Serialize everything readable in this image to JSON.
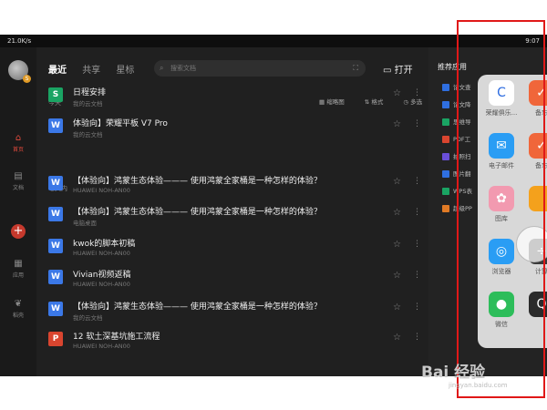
{
  "status": {
    "left": "21.0K/s",
    "right": "9:07"
  },
  "sidebar": {
    "items": [
      {
        "label": "首页"
      },
      {
        "label": "文档"
      },
      {
        "label": "应用"
      },
      {
        "label": "稻壳"
      }
    ]
  },
  "topnav": {
    "tabs": [
      "最近",
      "共享",
      "星标"
    ],
    "open_label": "打开"
  },
  "search": {
    "placeholder": "搜索文档"
  },
  "toolbar": {
    "thumb": "缩略图",
    "format": "格式",
    "multiselect": "多选"
  },
  "sections": {
    "today": "今天",
    "week": "七天内"
  },
  "docs": [
    {
      "icon": "S",
      "color": "#1aa463",
      "title": "日程安排",
      "sub": "我的云文档"
    },
    {
      "icon": "W",
      "color": "#3b78e7",
      "title": "体验向】荣耀平板 V7 Pro",
      "sub": "我的云文档"
    },
    {
      "icon": "W",
      "color": "#3b78e7",
      "title": "【体验向】鸿蒙生态体验——— 使用鸿蒙全家桶是一种怎样的体验？",
      "sub": "HUAWEI NOH-AN00"
    },
    {
      "icon": "W",
      "color": "#3b78e7",
      "title": "【体验向】鸿蒙生态体验——— 使用鸿蒙全家桶是一种怎样的体验？",
      "sub": "电脑桌面"
    },
    {
      "icon": "W",
      "color": "#3b78e7",
      "title": "kwok的脚本初稿",
      "sub": "HUAWEI NOH-AN00"
    },
    {
      "icon": "W",
      "color": "#3b78e7",
      "title": "Vivian视频返稿",
      "sub": "HUAWEI NOH-AN00"
    },
    {
      "icon": "W",
      "color": "#3b78e7",
      "title": "【体验向】鸿蒙生态体验——— 使用鸿蒙全家桶是一种怎样的体验？",
      "sub": "我的云文档"
    },
    {
      "icon": "P",
      "color": "#d9452f",
      "title": "12 软土深基坑施工流程",
      "sub": "HUAWEI NOH-AN00"
    }
  ],
  "recommended": {
    "title": "推荐应用",
    "items": [
      {
        "label": "论文查",
        "color": "#2f6fe0"
      },
      {
        "label": "论文降",
        "color": "#2f6fe0"
      },
      {
        "label": "思维导",
        "color": "#1aa463"
      },
      {
        "label": "PDF工",
        "color": "#d9452f"
      },
      {
        "label": "拍照扫",
        "color": "#6a4fd8"
      },
      {
        "label": "图片翻",
        "color": "#2f6fe0"
      },
      {
        "label": "WPS表",
        "color": "#1aa463"
      },
      {
        "label": "超级PP",
        "color": "#e07a25"
      }
    ]
  },
  "apps": [
    {
      "label": "荣耀俱乐...",
      "color": "#ffffff",
      "glyph": "C"
    },
    {
      "label": "备忘",
      "color": "#f0663a",
      "glyph": "✓"
    },
    {
      "label": "电子邮件",
      "color": "#2a9df4",
      "glyph": "✉"
    },
    {
      "label": "备忘",
      "color": "#f0663a",
      "glyph": "✓"
    },
    {
      "label": "图库",
      "color": "#f29ab0",
      "glyph": "✿"
    },
    {
      "label": "",
      "color": "#f4a11c",
      "glyph": ""
    },
    {
      "label": "浏览器",
      "color": "#2a9df4",
      "glyph": "◎"
    },
    {
      "label": "计算",
      "color": "#3a3a3a",
      "glyph": "÷"
    },
    {
      "label": "微信",
      "color": "#2dbd5a",
      "glyph": "●"
    },
    {
      "label": "",
      "color": "#2b2b2b",
      "glyph": "Q"
    }
  ],
  "watermark": {
    "text": "Bai 经验",
    "sub": "jingyan.baidu.com"
  }
}
